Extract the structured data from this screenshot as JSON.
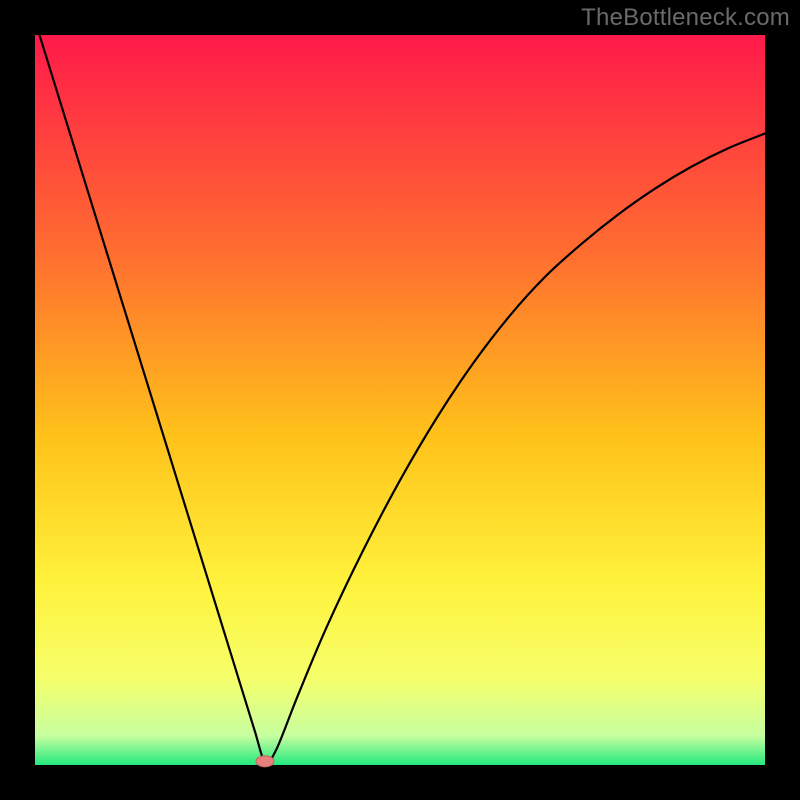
{
  "watermark": {
    "text": "TheBottleneck.com"
  },
  "colors": {
    "black": "#000000",
    "curve": "#000000",
    "marker_fill": "#e7817f",
    "marker_stroke": "#c76260",
    "grad_top": "#ff1a4a",
    "grad_1": "#ff6e30",
    "grad_2": "#ffc21a",
    "grad_3": "#fff23c",
    "grad_4": "#f6ff6a",
    "grad_5": "#c7ffa0",
    "grad_bottom": "#23e87e"
  },
  "chart_data": {
    "type": "line",
    "title": "",
    "xlabel": "",
    "ylabel": "",
    "xlim": [
      0,
      100
    ],
    "ylim": [
      0,
      100
    ],
    "grid": false,
    "legend": false,
    "series": [
      {
        "name": "bottleneck-curve",
        "x": [
          0,
          3,
          6,
          9,
          12,
          15,
          18,
          21,
          24,
          27,
          30,
          31.5,
          33,
          36,
          40,
          45,
          50,
          55,
          60,
          65,
          70,
          75,
          80,
          85,
          90,
          95,
          100
        ],
        "y": [
          102,
          92.3,
          82.6,
          72.9,
          63.2,
          53.5,
          43.8,
          34.1,
          24.4,
          14.7,
          5.0,
          0.5,
          2.0,
          9.5,
          19.0,
          29.5,
          39.0,
          47.5,
          55.0,
          61.5,
          67.0,
          71.5,
          75.5,
          79.0,
          82.0,
          84.5,
          86.5
        ]
      }
    ],
    "annotations": [
      {
        "name": "min-marker",
        "x": 31.5,
        "y": 0.5,
        "shape": "ellipse"
      }
    ],
    "background_gradient": [
      "#ff1a4a",
      "#ff6e30",
      "#ffc21a",
      "#fff23c",
      "#f6ff6a",
      "#c7ffa0",
      "#23e87e"
    ]
  }
}
